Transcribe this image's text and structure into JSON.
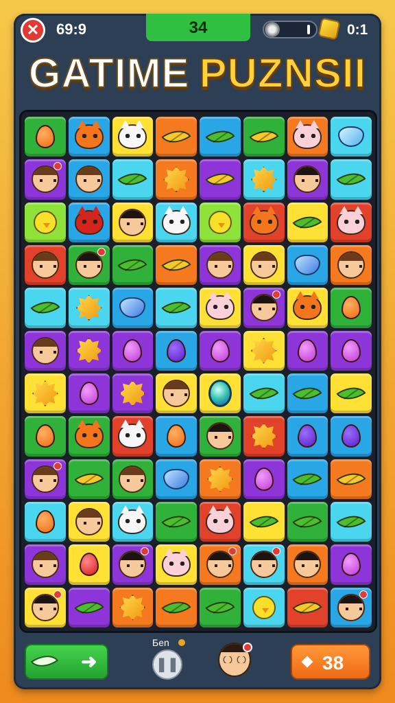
{
  "hud": {
    "close_icon": "close-icon",
    "close_glyph": "✕",
    "timer": "69:9",
    "score": "34",
    "coin_icon": "coin-icon",
    "coins": "0:1"
  },
  "title": {
    "part1": "GATIME",
    "part2": "PUZNSII"
  },
  "board": {
    "columns": 8,
    "rows": 12,
    "tiles": [
      [
        "green:drop-orange",
        "blue:cat-orange",
        "yellow:cat-white",
        "orange:leaf-yellow",
        "blue:leaf-green",
        "green:leaf-yellow",
        "orange:cat-pink",
        "cyan:crystal-cyan"
      ],
      [
        "purple:face-badge",
        "blue:face",
        "cyan:leaf-green",
        "orange:star",
        "purple:leaf-yellow",
        "cyan:star",
        "purple:face-dark",
        "cyan:leaf-green"
      ],
      [
        "lime:chick",
        "blue:cat-red",
        "yellow:face-dark",
        "cyan:cat-white",
        "lime:chick",
        "red:cat-orange",
        "yellow:leaf-green",
        "red:cat-pink"
      ],
      [
        "red:face",
        "green:face-dark-badge",
        "green:leaf-green",
        "orange:leaf-yellow",
        "purple:face",
        "yellow:face",
        "blue:crystal",
        "orange:face"
      ],
      [
        "cyan:leaf-green",
        "cyan:star",
        "blue:crystal",
        "cyan:leaf-green",
        "yellow:cat-pink",
        "purple:face-dark-badge",
        "yellow:cat-orange",
        "green:drop-orange"
      ],
      [
        "purple:face",
        "purple:star",
        "purple:drop-violet",
        "blue:drop-purple",
        "purple:drop-violet",
        "yellow:star",
        "purple:drop-violet",
        "purple:drop-violet"
      ],
      [
        "yellow:star",
        "purple:drop-violet",
        "purple:star",
        "yellow:face",
        "yellow:gem",
        "cyan:leaf-green",
        "blue:leaf-green",
        "yellow:leaf-green"
      ],
      [
        "green:drop-orange",
        "green:cat-orange",
        "red:cat-white",
        "blue:drop-orange",
        "green:face-dark",
        "red:star",
        "blue:drop-purple",
        "blue:drop-purple"
      ],
      [
        "purple:face-badge",
        "green:leaf-yellow",
        "green:face",
        "blue:crystal",
        "orange:star",
        "purple:drop-violet",
        "blue:leaf-green",
        "orange:leaf-yellow"
      ],
      [
        "cyan:drop-orange",
        "yellow:face",
        "cyan:cat-white",
        "green:leaf-green",
        "red:cat-pink",
        "yellow:leaf-green",
        "green:leaf-green",
        "cyan:leaf-green"
      ],
      [
        "purple:face",
        "yellow:drop-red",
        "purple:face-dark-badge",
        "yellow:cat-pink",
        "orange:face-dark-badge",
        "cyan:face-dark-badge",
        "orange:face-dark",
        "purple:drop-violet"
      ],
      [
        "yellow:face-dark-badge",
        "purple:leaf-green",
        "orange:star",
        "orange:leaf-green",
        "green:leaf-green",
        "cyan:chick",
        "red:leaf-yellow",
        "blue:face-dark-badge"
      ]
    ]
  },
  "footer": {
    "hint_icon": "leaf-icon",
    "hint_arrow": "➜",
    "player_label": "Бen",
    "pause_glyph": "❚❚",
    "moves_icon": "diamond-icon",
    "moves": "38"
  }
}
